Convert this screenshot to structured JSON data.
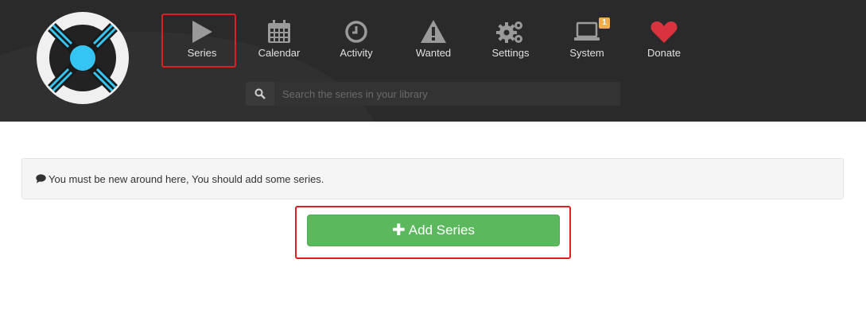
{
  "nav": {
    "items": [
      {
        "label": "Series",
        "icon": "play-icon"
      },
      {
        "label": "Calendar",
        "icon": "calendar-icon"
      },
      {
        "label": "Activity",
        "icon": "clock-icon"
      },
      {
        "label": "Wanted",
        "icon": "warning-icon"
      },
      {
        "label": "Settings",
        "icon": "gears-icon"
      },
      {
        "label": "System",
        "icon": "laptop-icon"
      },
      {
        "label": "Donate",
        "icon": "heart-icon"
      }
    ],
    "system_badge": "1"
  },
  "search": {
    "placeholder": "Search the series in your library"
  },
  "main": {
    "message": "You must be new around here, You should add some series.",
    "add_button_label": "Add Series"
  },
  "colors": {
    "header_bg": "#2a2a2a",
    "accent": "#35c5f4",
    "add_button": "#5cb85c",
    "heart": "#d9333f",
    "badge": "#f0ad4e",
    "highlight": "#e02020"
  }
}
